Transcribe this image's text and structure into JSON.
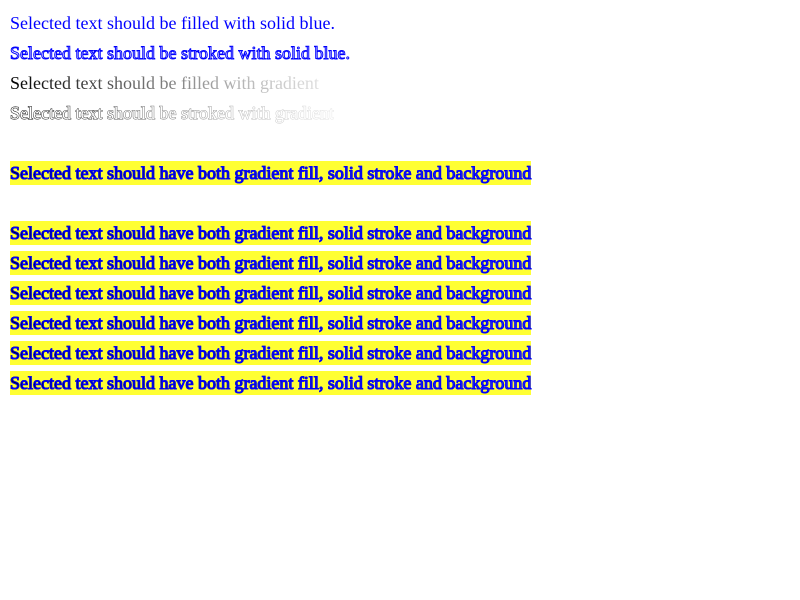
{
  "lines": {
    "l1": "Selected text should be filled with solid blue.",
    "l2": "Selected text should be stroked with solid blue.",
    "l3": "Selected text should be filled with gradient",
    "l4": "Selected text should be stroked with gradient",
    "combo": "Selected text should have both gradient fill, solid stroke and background"
  },
  "colors": {
    "solid_blue": "#0000ff",
    "highlight_yellow": "#ffff33",
    "background": "#ffffff"
  }
}
